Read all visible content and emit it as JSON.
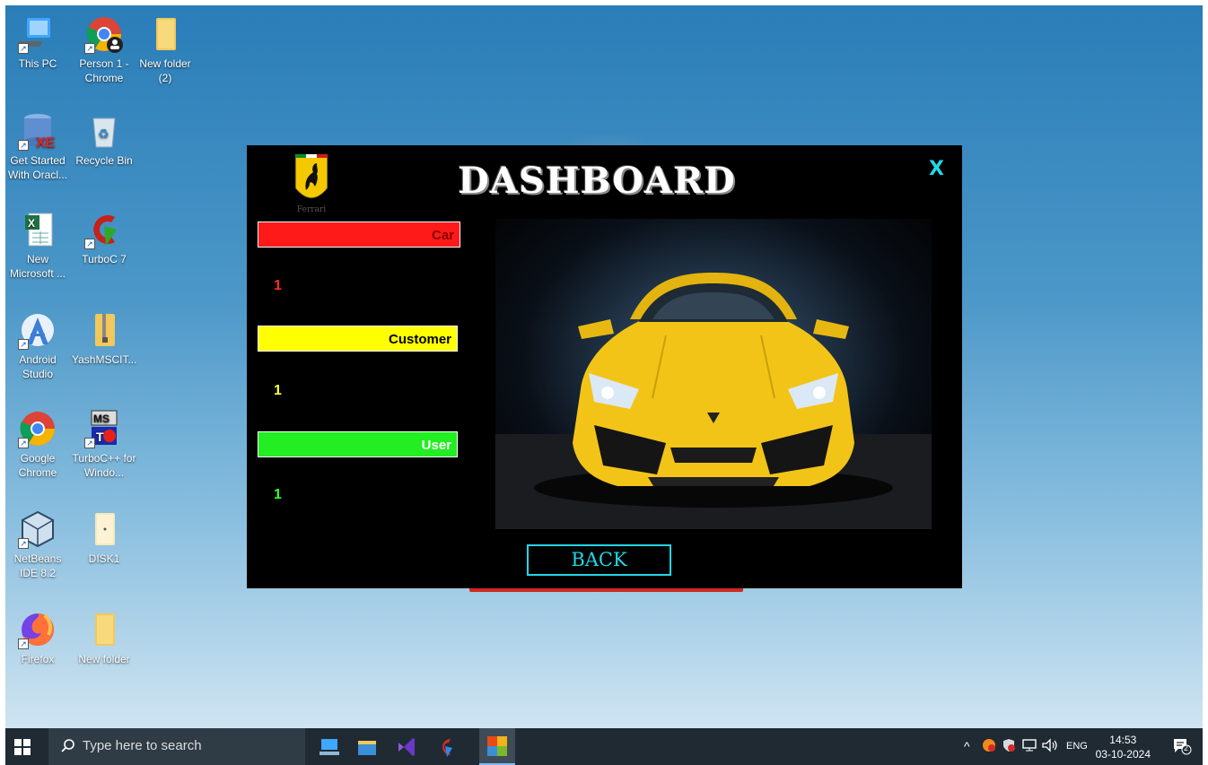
{
  "desktop_icons": [
    {
      "id": "this-pc",
      "label": "This PC"
    },
    {
      "id": "chrome-person",
      "label": "Person 1 - Chrome"
    },
    {
      "id": "new-folder-2",
      "label": "New folder (2)"
    },
    {
      "id": "oracle",
      "label": "Get Started With Oracl..."
    },
    {
      "id": "recycle-bin",
      "label": "Recycle Bin"
    },
    {
      "id": "excel",
      "label": "New Microsoft ..."
    },
    {
      "id": "turboc7",
      "label": "TurboC 7"
    },
    {
      "id": "android-studio",
      "label": "Android Studio"
    },
    {
      "id": "yash-folder",
      "label": "YashMSCIT..."
    },
    {
      "id": "google-chrome",
      "label": "Google Chrome"
    },
    {
      "id": "turbocpp",
      "label": "TurboC++ for Windo..."
    },
    {
      "id": "netbeans",
      "label": "NetBeans IDE 8.2"
    },
    {
      "id": "disk1",
      "label": "DISK1"
    },
    {
      "id": "firefox",
      "label": "Firefox"
    },
    {
      "id": "new-folder",
      "label": "New folder"
    }
  ],
  "dialog": {
    "title": "DASHBOARD",
    "close_label": "X",
    "logo_text": "Ferrari",
    "stats": [
      {
        "label": "Car",
        "value": "1",
        "bar_color": "#ff1a1a",
        "value_color": "#ff2a2a"
      },
      {
        "label": "Customer",
        "value": "1",
        "bar_color": "#ffff00",
        "value_color": "#ffff33"
      },
      {
        "label": "User",
        "value": "1",
        "bar_color": "#22ee22",
        "value_color": "#33ff33"
      }
    ],
    "back_label": "BACK"
  },
  "taskbar": {
    "search_placeholder": "Type here to search",
    "language": "ENG",
    "time": "14:53",
    "date": "03-10-2024",
    "notification_count": "2"
  },
  "colors": {
    "accent_cyan": "#22d8e6",
    "taskbar_bg": "#1f2a33",
    "car_yellow": "#f2c417"
  }
}
